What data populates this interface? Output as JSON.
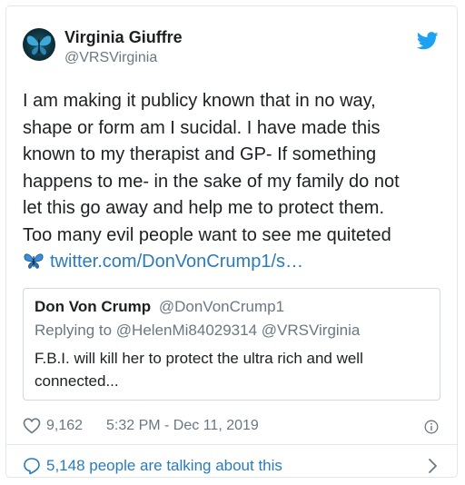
{
  "author": {
    "name": "Virginia Giuffre",
    "handle": "@VRSVirginia"
  },
  "tweet": {
    "lines": [
      "I am making it publicy known that in no way,",
      "shape or form am I sucidal. I have made this",
      "known to my therapist and GP- If something",
      "happens to me- in the sake of my family do not",
      "let this go away and help me to protect them.",
      "Too many evil people want to see me quiteted"
    ],
    "emoji_icon": "butterfly-icon",
    "link": "twitter.com/DonVonCrump1/s…"
  },
  "quote": {
    "name": "Don Von Crump",
    "handle": "@DonVonCrump1",
    "reply_prefix": "Replying to",
    "reply_mentions": "@HelenMi84029314 @VRSVirginia",
    "text_lines": [
      "F.B.I. will kill her to protect the ultra rich and well",
      "connected..."
    ]
  },
  "meta": {
    "likes": "9,162",
    "timestamp": "5:32 PM - Dec 11, 2019"
  },
  "footer": {
    "talking": "5,148 people are talking about this"
  },
  "colors": {
    "link": "#2b7bb9",
    "muted": "#697882",
    "text": "#1c2022",
    "border": "#e1e8ed",
    "twitter_blue": "#1da1f2"
  }
}
